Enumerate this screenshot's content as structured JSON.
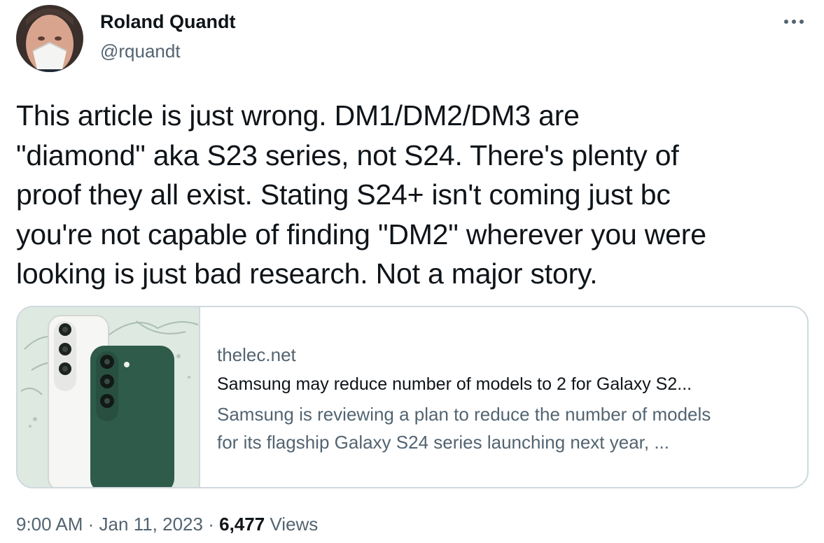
{
  "author": {
    "name": "Roland Quandt",
    "handle": "@rquandt"
  },
  "tweet": {
    "text": "This article is just wrong. DM1/DM2/DM3 are\n\"diamond\" aka S23 series, not S24. There's plenty of\nproof they all exist. Stating S24+ isn't coming just bc\nyou're not capable of finding \"DM2\" wherever you were\nlooking is just bad research. Not a major story."
  },
  "card": {
    "domain": "thelec.net",
    "title": "Samsung may reduce number of models to 2 for Galaxy S2...",
    "description_line1": "Samsung is reviewing a plan to reduce the number of models",
    "description_line2": "for its flagship Galaxy S24 series launching next year, ...",
    "image": "galaxy-phones-water-splash"
  },
  "meta": {
    "time": "9:00 AM",
    "separator": "·",
    "date": "Jan 11, 2023",
    "views_count": "6,477",
    "views_label": "Views"
  },
  "icons": {
    "more": "more-horizontal-icon"
  },
  "colors": {
    "text_primary": "#0f1419",
    "text_secondary": "#536471",
    "border": "#cfd9de",
    "phone_green": "#2f5b4a",
    "card_bg_mint": "#dde9e1"
  }
}
